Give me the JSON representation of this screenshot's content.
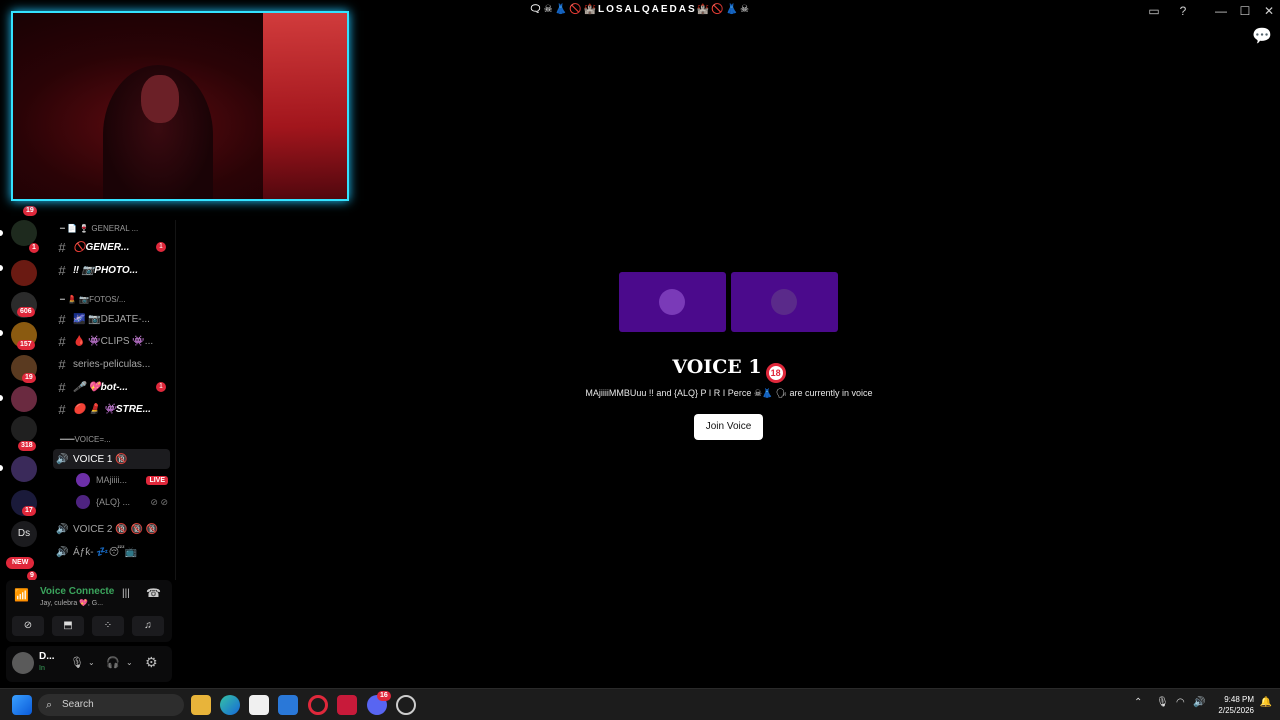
{
  "window": {
    "title": "🗨☠👗🚫🏰LOSALQAEDAS🏰🚫👗☠"
  },
  "rail": {
    "badges": [
      "19",
      "1",
      "606",
      "157",
      "19",
      "318",
      "17",
      "NEW",
      "9"
    ],
    "ds_label": "Ds"
  },
  "channels": {
    "cat1": "━ 📄 🍷 GENERAL ...",
    "general": "🚫GENER...",
    "general_badge": "1",
    "photo": "‼ 📷PHOTO...",
    "cat2": "━ 💄 📷FOTOS/...",
    "dejate": "🌌 📷DEJATE-...",
    "clips": "🩸 👾CLIPS 👾...",
    "series": "series-peliculas...",
    "bot": "🎤 💖bot-...",
    "bot_badge": "1",
    "stre": "🔴 💄 👾STRE...",
    "cat3": "━━━VOICE=...",
    "voice1": "VOICE 1 🔞",
    "voice1_users": [
      {
        "name": "MAjiiii...",
        "badge": "LIVE"
      },
      {
        "name": "{ALQ} ...",
        "badge": ""
      }
    ],
    "voice2": "VOICE 2 🔞 🔞 🔞",
    "afk": "Áƒƙ- 💤😴📺"
  },
  "voice_panel": {
    "status": "Voice Connecte",
    "sub": "Jay, culebra 💖, G..."
  },
  "user_panel": {
    "name": "D...",
    "status": "In"
  },
  "main": {
    "title": "VOICE 1",
    "title_icon": "18",
    "subtitle": "MAjiiiiMMBUuu !! and {ALQ} P I R I Perce ☠👗 🗣 are currently in voice",
    "join_label": "Join Voice"
  },
  "taskbar": {
    "search_label": "Search",
    "time": "9:48 PM",
    "date": "2/25/2026",
    "discord_badge": "16"
  }
}
